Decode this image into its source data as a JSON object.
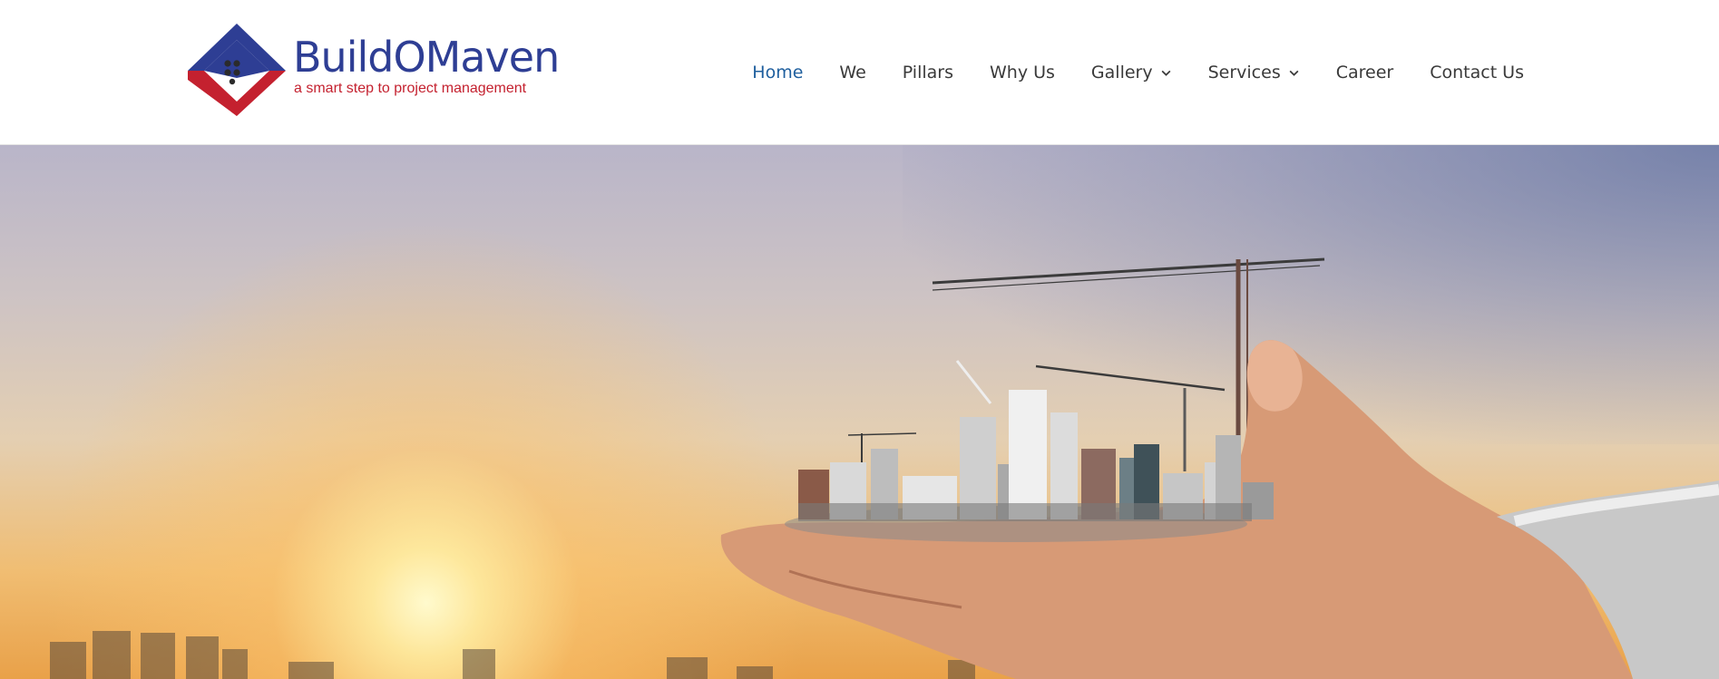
{
  "brand": {
    "name": "BuildOMaven",
    "tagline": "a smart step to project management",
    "primary_color": "#2e3e94",
    "accent_color": "#c4212f"
  },
  "nav": {
    "items": [
      {
        "label": "Home",
        "active": true
      },
      {
        "label": "We"
      },
      {
        "label": "Pillars"
      },
      {
        "label": "Why Us"
      },
      {
        "label": "Gallery",
        "dropdown": true
      },
      {
        "label": "Services",
        "dropdown": true
      },
      {
        "label": "Career"
      },
      {
        "label": "Contact Us"
      }
    ],
    "active_color": "#1f5f9e",
    "text_color": "#3a3a3a"
  },
  "hero": {
    "image": "hand-holding-city-with-cranes-at-sunset"
  }
}
